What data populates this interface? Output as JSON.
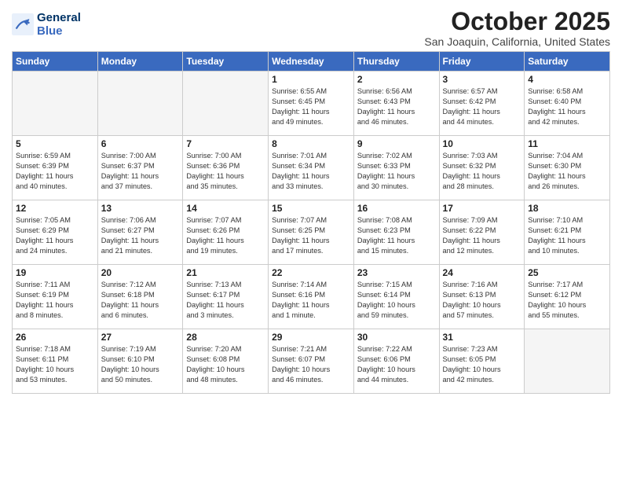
{
  "header": {
    "logo_line1": "General",
    "logo_line2": "Blue",
    "title": "October 2025",
    "location": "San Joaquin, California, United States"
  },
  "days_of_week": [
    "Sunday",
    "Monday",
    "Tuesday",
    "Wednesday",
    "Thursday",
    "Friday",
    "Saturday"
  ],
  "weeks": [
    [
      {
        "day": "",
        "info": ""
      },
      {
        "day": "",
        "info": ""
      },
      {
        "day": "",
        "info": ""
      },
      {
        "day": "1",
        "info": "Sunrise: 6:55 AM\nSunset: 6:45 PM\nDaylight: 11 hours\nand 49 minutes."
      },
      {
        "day": "2",
        "info": "Sunrise: 6:56 AM\nSunset: 6:43 PM\nDaylight: 11 hours\nand 46 minutes."
      },
      {
        "day": "3",
        "info": "Sunrise: 6:57 AM\nSunset: 6:42 PM\nDaylight: 11 hours\nand 44 minutes."
      },
      {
        "day": "4",
        "info": "Sunrise: 6:58 AM\nSunset: 6:40 PM\nDaylight: 11 hours\nand 42 minutes."
      }
    ],
    [
      {
        "day": "5",
        "info": "Sunrise: 6:59 AM\nSunset: 6:39 PM\nDaylight: 11 hours\nand 40 minutes."
      },
      {
        "day": "6",
        "info": "Sunrise: 7:00 AM\nSunset: 6:37 PM\nDaylight: 11 hours\nand 37 minutes."
      },
      {
        "day": "7",
        "info": "Sunrise: 7:00 AM\nSunset: 6:36 PM\nDaylight: 11 hours\nand 35 minutes."
      },
      {
        "day": "8",
        "info": "Sunrise: 7:01 AM\nSunset: 6:34 PM\nDaylight: 11 hours\nand 33 minutes."
      },
      {
        "day": "9",
        "info": "Sunrise: 7:02 AM\nSunset: 6:33 PM\nDaylight: 11 hours\nand 30 minutes."
      },
      {
        "day": "10",
        "info": "Sunrise: 7:03 AM\nSunset: 6:32 PM\nDaylight: 11 hours\nand 28 minutes."
      },
      {
        "day": "11",
        "info": "Sunrise: 7:04 AM\nSunset: 6:30 PM\nDaylight: 11 hours\nand 26 minutes."
      }
    ],
    [
      {
        "day": "12",
        "info": "Sunrise: 7:05 AM\nSunset: 6:29 PM\nDaylight: 11 hours\nand 24 minutes."
      },
      {
        "day": "13",
        "info": "Sunrise: 7:06 AM\nSunset: 6:27 PM\nDaylight: 11 hours\nand 21 minutes."
      },
      {
        "day": "14",
        "info": "Sunrise: 7:07 AM\nSunset: 6:26 PM\nDaylight: 11 hours\nand 19 minutes."
      },
      {
        "day": "15",
        "info": "Sunrise: 7:07 AM\nSunset: 6:25 PM\nDaylight: 11 hours\nand 17 minutes."
      },
      {
        "day": "16",
        "info": "Sunrise: 7:08 AM\nSunset: 6:23 PM\nDaylight: 11 hours\nand 15 minutes."
      },
      {
        "day": "17",
        "info": "Sunrise: 7:09 AM\nSunset: 6:22 PM\nDaylight: 11 hours\nand 12 minutes."
      },
      {
        "day": "18",
        "info": "Sunrise: 7:10 AM\nSunset: 6:21 PM\nDaylight: 11 hours\nand 10 minutes."
      }
    ],
    [
      {
        "day": "19",
        "info": "Sunrise: 7:11 AM\nSunset: 6:19 PM\nDaylight: 11 hours\nand 8 minutes."
      },
      {
        "day": "20",
        "info": "Sunrise: 7:12 AM\nSunset: 6:18 PM\nDaylight: 11 hours\nand 6 minutes."
      },
      {
        "day": "21",
        "info": "Sunrise: 7:13 AM\nSunset: 6:17 PM\nDaylight: 11 hours\nand 3 minutes."
      },
      {
        "day": "22",
        "info": "Sunrise: 7:14 AM\nSunset: 6:16 PM\nDaylight: 11 hours\nand 1 minute."
      },
      {
        "day": "23",
        "info": "Sunrise: 7:15 AM\nSunset: 6:14 PM\nDaylight: 10 hours\nand 59 minutes."
      },
      {
        "day": "24",
        "info": "Sunrise: 7:16 AM\nSunset: 6:13 PM\nDaylight: 10 hours\nand 57 minutes."
      },
      {
        "day": "25",
        "info": "Sunrise: 7:17 AM\nSunset: 6:12 PM\nDaylight: 10 hours\nand 55 minutes."
      }
    ],
    [
      {
        "day": "26",
        "info": "Sunrise: 7:18 AM\nSunset: 6:11 PM\nDaylight: 10 hours\nand 53 minutes."
      },
      {
        "day": "27",
        "info": "Sunrise: 7:19 AM\nSunset: 6:10 PM\nDaylight: 10 hours\nand 50 minutes."
      },
      {
        "day": "28",
        "info": "Sunrise: 7:20 AM\nSunset: 6:08 PM\nDaylight: 10 hours\nand 48 minutes."
      },
      {
        "day": "29",
        "info": "Sunrise: 7:21 AM\nSunset: 6:07 PM\nDaylight: 10 hours\nand 46 minutes."
      },
      {
        "day": "30",
        "info": "Sunrise: 7:22 AM\nSunset: 6:06 PM\nDaylight: 10 hours\nand 44 minutes."
      },
      {
        "day": "31",
        "info": "Sunrise: 7:23 AM\nSunset: 6:05 PM\nDaylight: 10 hours\nand 42 minutes."
      },
      {
        "day": "",
        "info": ""
      }
    ]
  ]
}
